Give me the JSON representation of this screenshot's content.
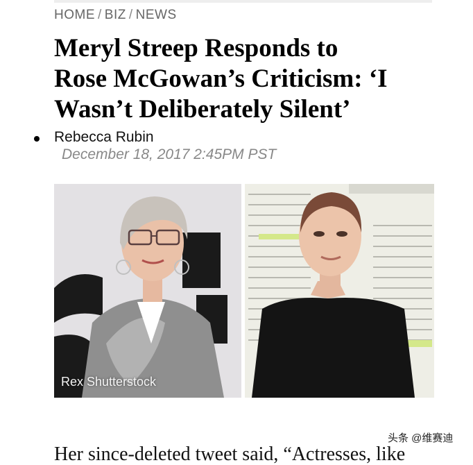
{
  "breadcrumb": {
    "items": [
      "HOME",
      "BIZ",
      "NEWS"
    ],
    "separator": "/"
  },
  "article": {
    "headline_lines": [
      "Meryl Streep Responds to",
      "Rose McGowan’s Criticism: ‘I",
      "Wasn’t Deliberately Silent’"
    ],
    "author": "Rebecca Rubin",
    "date": "December 18, 2017 2:45PM PST",
    "photo_credit": "Rex Shutterstock",
    "body_start": "Her since-deleted tweet said, “Actresses, like"
  },
  "watermark": "头条 @维赛迪",
  "colors": {
    "breadcrumb": "#666666",
    "date": "#888888",
    "headline": "#000000"
  }
}
